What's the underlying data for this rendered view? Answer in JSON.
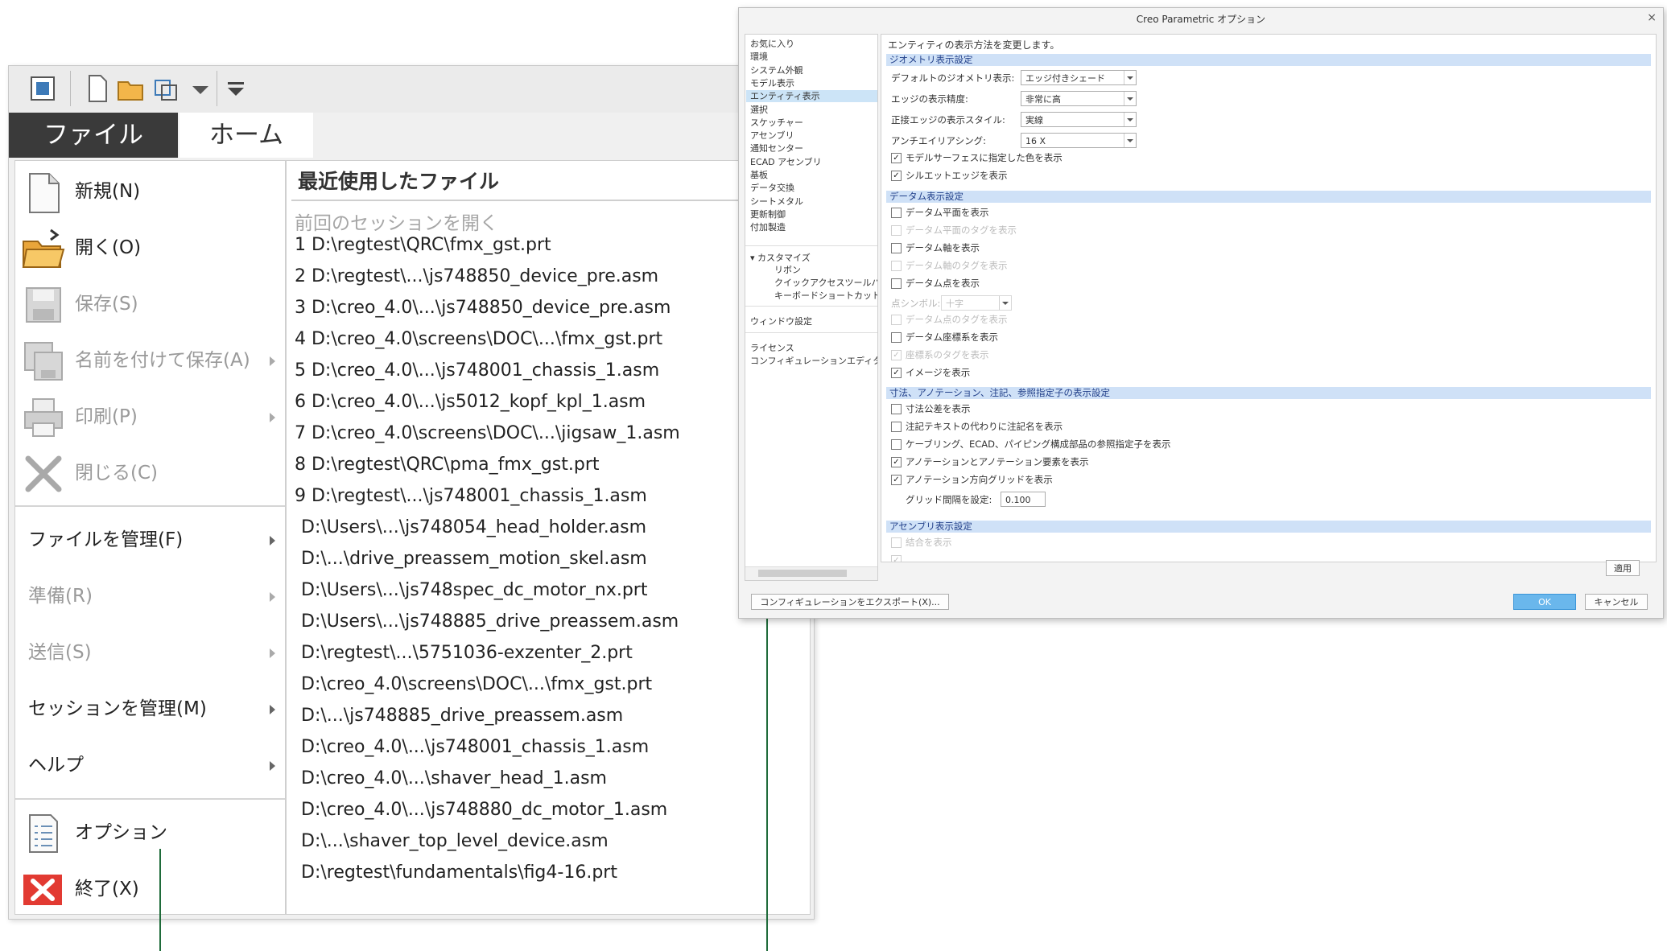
{
  "file_menu": {
    "tabs": {
      "file": "ファイル",
      "home": "ホーム"
    },
    "left_items_top": [
      {
        "label": "新規(N)",
        "icon": "new-document-icon",
        "disabled": false,
        "arrow": false
      },
      {
        "label": "開く(O)",
        "icon": "open-folder-icon",
        "disabled": false,
        "arrow": false
      },
      {
        "label": "保存(S)",
        "icon": "save-icon",
        "disabled": true,
        "arrow": false
      },
      {
        "label": "名前を付けて保存(A)",
        "icon": "save-as-icon",
        "disabled": true,
        "arrow": true
      },
      {
        "label": "印刷(P)",
        "icon": "print-icon",
        "disabled": true,
        "arrow": true
      },
      {
        "label": "閉じる(C)",
        "icon": "close-icon",
        "disabled": true,
        "arrow": false
      }
    ],
    "left_items_middle": [
      {
        "label": "ファイルを管理(F)",
        "disabled": false
      },
      {
        "label": "準備(R)",
        "disabled": true
      },
      {
        "label": "送信(S)",
        "disabled": true
      },
      {
        "label": "セッションを管理(M)",
        "disabled": false
      },
      {
        "label": "ヘルプ",
        "disabled": false
      }
    ],
    "left_items_bottom": [
      {
        "label": "オプション",
        "icon": "options-icon"
      },
      {
        "label": "終了(X)",
        "icon": "exit-icon"
      }
    ],
    "recent_title": "最近使用したファイル",
    "recent_previous": "前回のセッションを開く",
    "recent_files": [
      "1 D:\\regtest\\QRC\\fmx_gst.prt",
      "2 D:\\regtest\\...\\js748850_device_pre.asm",
      "3 D:\\creo_4.0\\...\\js748850_device_pre.asm",
      "4 D:\\creo_4.0\\screens\\DOC\\...\\fmx_gst.prt",
      "5 D:\\creo_4.0\\...\\js748001_chassis_1.asm",
      "6 D:\\creo_4.0\\...\\js5012_kopf_kpl_1.asm",
      "7 D:\\creo_4.0\\screens\\DOC\\...\\jigsaw_1.asm",
      "8 D:\\regtest\\QRC\\pma_fmx_gst.prt",
      "9 D:\\regtest\\...\\js748001_chassis_1.asm",
      "D:\\Users\\...\\js748054_head_holder.asm",
      "D:\\...\\drive_preassem_motion_skel.asm",
      "D:\\Users\\...\\js748spec_dc_motor_nx.prt",
      "D:\\Users\\...\\js748885_drive_preassem.asm",
      "D:\\regtest\\...\\5751036-exzenter_2.prt",
      "D:\\creo_4.0\\screens\\DOC\\...\\fmx_gst.prt",
      "D:\\...\\js748885_drive_preassem.asm",
      "D:\\creo_4.0\\...\\js748001_chassis_1.asm",
      "D:\\creo_4.0\\...\\shaver_head_1.asm",
      "D:\\creo_4.0\\...\\js748880_dc_motor_1.asm",
      "D:\\...\\shaver_top_level_device.asm",
      "D:\\regtest\\fundamentals\\fig4-16.prt"
    ]
  },
  "dialog": {
    "title": "Creo Parametric オプション",
    "close": "×",
    "nav_items": [
      "お気に入り",
      "環境",
      "システム外観",
      "モデル表示",
      "エンティティ表示",
      "選択",
      "スケッチャー",
      "アセンブリ",
      "通知センター",
      "ECAD アセンブリ",
      "基板",
      "データ交換",
      "シートメタル",
      "更新制御",
      "付加製造"
    ],
    "nav_selected": 4,
    "nav_customize": "カスタマイズ",
    "nav_customize_children": [
      "リボン",
      "クイックアクセスツールバー",
      "キーボードショートカット"
    ],
    "nav_window": "ウィンドウ設定",
    "nav_license": "ライセンス",
    "nav_config": "コンフィギュレーションエディタ",
    "description": "エンティティの表示方法を変更します。",
    "geometry": {
      "header": "ジオメトリ表示設定",
      "default_display_label": "デフォルトのジオメトリ表示:",
      "default_display_value": "エッジ付きシェード",
      "edge_quality_label": "エッジの表示精度:",
      "edge_quality_value": "非常に高",
      "tangent_style_label": "正接エッジの表示スタイル:",
      "tangent_style_value": "実線",
      "antialias_label": "アンチエイリアシング:",
      "antialias_value": "16 X",
      "cb_surface_color": "モデルサーフェスに指定した色を表示",
      "cb_silhouette": "シルエットエッジを表示"
    },
    "datum": {
      "header": "データム表示設定",
      "cb_planes": "データム平面を表示",
      "cb_plane_tags": "データム平面のタグを表示",
      "cb_axes": "データム軸を表示",
      "cb_axis_tags": "データム軸のタグを表示",
      "cb_points": "データム点を表示",
      "point_symbol_label": "点シンボル:",
      "point_symbol_value": "十字",
      "cb_point_tags": "データム点のタグを表示",
      "cb_csys": "データム座標系を表示",
      "cb_csys_tags": "座標系のタグを表示",
      "cb_images": "イメージを表示"
    },
    "annotation": {
      "header": "寸法、アノテーション、注記、参照指定子の表示設定",
      "cb_tolerance": "寸法公差を表示",
      "cb_note_names": "注記テキストの代わりに注記名を表示",
      "cb_cabling": "ケーブリング、ECAD、パイピング構成部品の参照指定子を表示",
      "cb_annotations": "アノテーションとアノテーション要素を表示",
      "cb_grid": "アノテーション方向グリッドを表示",
      "grid_label": "グリッド間隔を設定:",
      "grid_value": "0.100"
    },
    "assembly": {
      "header": "アセンブリ表示設定",
      "cb_combined": "結合を表示"
    },
    "apply": "適用",
    "export": "コンフィギュレーションをエクスポート(X)...",
    "ok": "OK",
    "cancel": "キャンセル"
  },
  "colors": {
    "file_tab": "#3a3a3a",
    "callout": "#1f6b3a",
    "selection": "#cce4f7",
    "ok_button": "#6ab7ec"
  }
}
